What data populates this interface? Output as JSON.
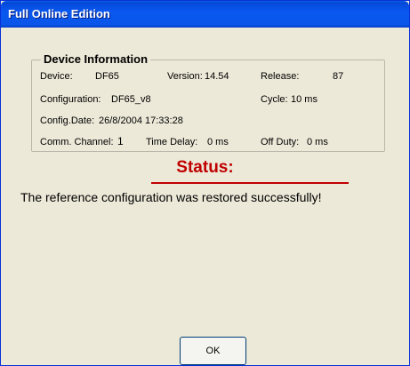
{
  "window": {
    "title": "Full Online Edition"
  },
  "device_info": {
    "group_label": "Device Information",
    "device_label": "Device:",
    "device_value": "DF65",
    "version_label": "Version:",
    "version_value": "14.54",
    "release_label": "Release:",
    "release_value": "87",
    "configuration_label": "Configuration:",
    "configuration_value": "DF65_v8",
    "cycle_label": "Cycle:",
    "cycle_value": "10 ms",
    "config_date_label": "Config.Date:",
    "config_date_value": "26/8/2004 17:33:28",
    "comm_channel_label": "Comm. Channel:",
    "comm_channel_value": "1",
    "time_delay_label": "Time Delay:",
    "time_delay_value": "0 ms",
    "off_duty_label": "Off Duty:",
    "off_duty_value": "0 ms"
  },
  "status": {
    "title": "Status:",
    "message": "The reference configuration was restored successfully!"
  },
  "buttons": {
    "ok_label": "OK"
  },
  "colors": {
    "status_accent": "#c00000",
    "titlebar": "#0a58f0",
    "dialog_background": "#ece9d8"
  }
}
